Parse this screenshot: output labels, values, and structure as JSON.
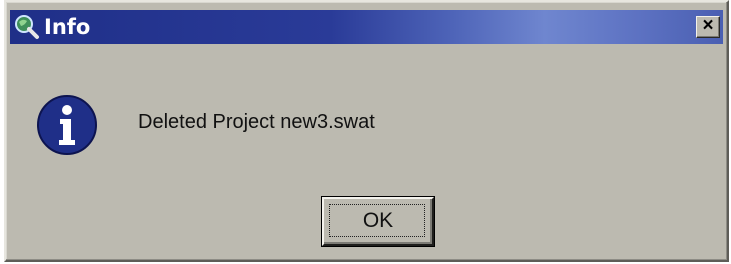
{
  "window": {
    "title": "Info",
    "title_icon": "magnifier-globe-icon",
    "close_label": "×"
  },
  "body": {
    "icon": "information-icon",
    "message": "Deleted Project new3.swat"
  },
  "buttons": {
    "ok_label": "OK"
  },
  "colors": {
    "titlebar_start": "#1f2f88",
    "titlebar_end": "#4a5fb2",
    "face": "#bcbab0",
    "info_icon_fill": "#1f2f88"
  }
}
